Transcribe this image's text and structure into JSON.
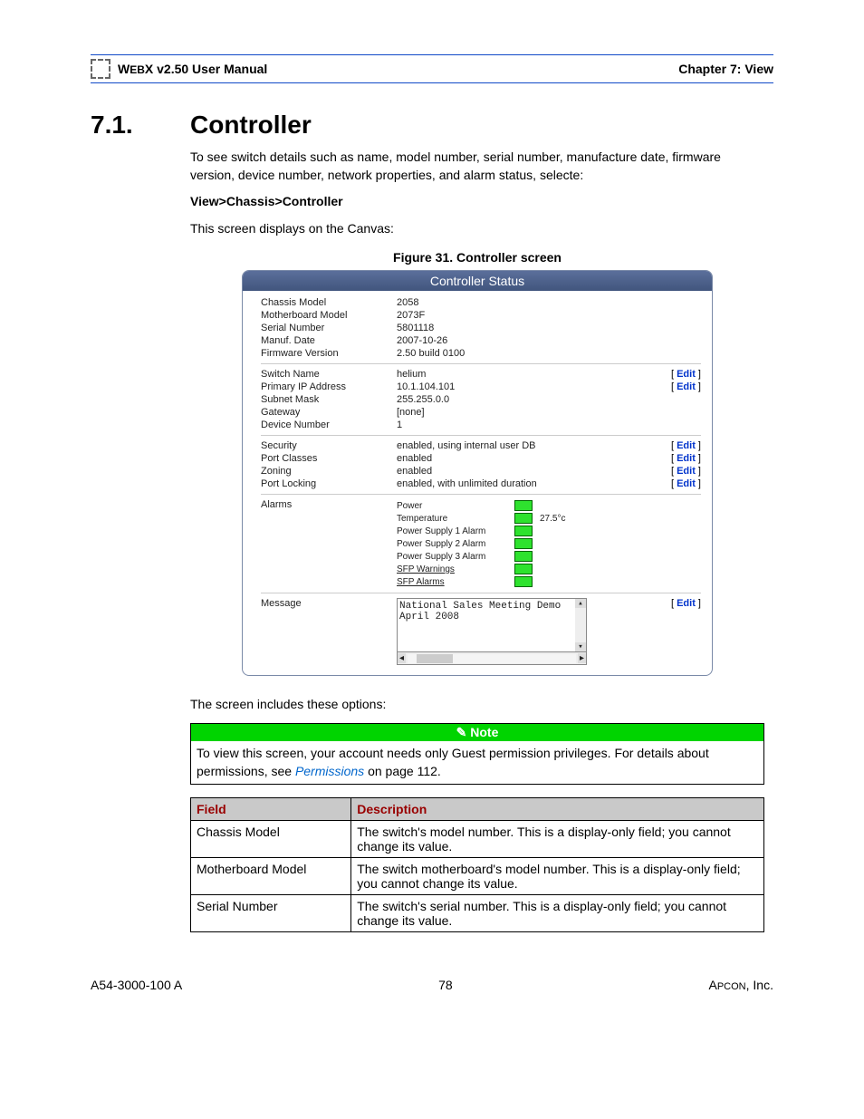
{
  "header": {
    "manual_left_small": "W",
    "manual_left_rest": "EB",
    "manual_title": "X v2.50 User Manual",
    "chapter": "Chapter 7: View"
  },
  "section": {
    "number": "7.1.",
    "title": "Controller",
    "intro": "To see switch details such as name, model number, serial number, manufacture date, firmware version, device number, network properties, and alarm status, selecte:",
    "navpath": "View>Chassis>Controller",
    "after_nav": "This screen displays on the Canvas:",
    "figure_caption": "Figure 31. Controller screen",
    "after_figure": "The screen includes these options:"
  },
  "panel": {
    "title": "Controller Status",
    "group1": [
      {
        "label": "Chassis Model",
        "value": "2058"
      },
      {
        "label": "Motherboard Model",
        "value": "2073F"
      },
      {
        "label": "Serial Number",
        "value": "5801118"
      },
      {
        "label": "Manuf. Date",
        "value": "2007-10-26"
      },
      {
        "label": "Firmware Version",
        "value": "2.50 build 0100"
      }
    ],
    "group2": [
      {
        "label": "Switch Name",
        "value": "helium",
        "edit": true
      },
      {
        "label": "Primary IP Address",
        "value": "10.1.104.101",
        "edit": true
      },
      {
        "label": "Subnet Mask",
        "value": "255.255.0.0"
      },
      {
        "label": "Gateway",
        "value": "[none]"
      },
      {
        "label": "Device Number",
        "value": "1"
      }
    ],
    "group3": [
      {
        "label": "Security",
        "value": "enabled, using internal user DB",
        "edit": true
      },
      {
        "label": "Port Classes",
        "value": "enabled",
        "edit": true
      },
      {
        "label": "Zoning",
        "value": "enabled",
        "edit": true
      },
      {
        "label": "Port Locking",
        "value": "enabled, with unlimited duration",
        "edit": true
      }
    ],
    "alarms_label": "Alarms",
    "alarms": [
      {
        "name": "Power",
        "extra": ""
      },
      {
        "name": "Temperature",
        "extra": "27.5°c"
      },
      {
        "name": "Power Supply 1 Alarm",
        "extra": ""
      },
      {
        "name": "Power Supply 2 Alarm",
        "extra": ""
      },
      {
        "name": "Power Supply 3 Alarm",
        "extra": ""
      },
      {
        "name": "SFP Warnings",
        "extra": "",
        "underline": true
      },
      {
        "name": "SFP Alarms",
        "extra": "",
        "underline": true
      }
    ],
    "message_label": "Message",
    "message_value": "National Sales Meeting Demo\nApril 2008",
    "message_edit": true,
    "edit_label": "Edit"
  },
  "note": {
    "head": "Note",
    "body_pre": "To view this screen, your account needs only Guest permission privileges. For details about permissions, see ",
    "link": "Permissions",
    "body_post": " on page 112."
  },
  "fields_table": {
    "headers": {
      "field": "Field",
      "desc": "Description"
    },
    "rows": [
      {
        "field": "Chassis Model",
        "desc": "The switch's model number. This is a display-only field; you cannot change its value."
      },
      {
        "field": "Motherboard Model",
        "desc": "The switch motherboard's model number. This is a display-only field; you cannot change its value."
      },
      {
        "field": "Serial Number",
        "desc": "The switch's serial number. This is a display-only field; you cannot change its value."
      }
    ]
  },
  "footer": {
    "left": "A54-3000-100 A",
    "center": "78",
    "right_pre": "A",
    "right_small": "PCON",
    "right_post": ", Inc."
  }
}
